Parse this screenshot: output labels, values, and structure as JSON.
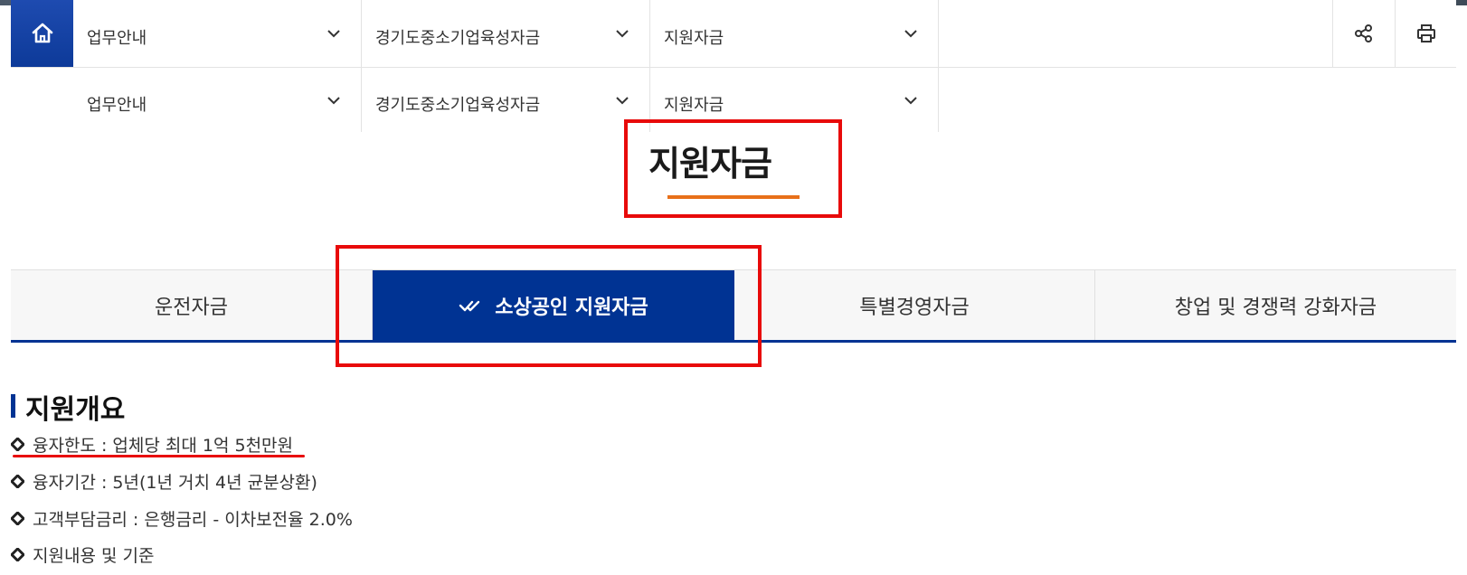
{
  "nav": {
    "row1": [
      "업무안내",
      "경기도중소기업육성자금",
      "지원자금"
    ],
    "row2": [
      "업무안내",
      "경기도중소기업육성자금",
      "지원자금"
    ]
  },
  "page_title": "지원자금",
  "tabs": [
    "운전자금",
    "소상공인 지원자금",
    "특별경영자금",
    "창업 및 경쟁력 강화자금"
  ],
  "active_tab_index": 1,
  "section_title": "지원개요",
  "items": [
    "융자한도 : 업체당 최대 1억 5천만원",
    "융자기간 : 5년(1년 거치 4년 균분상환)",
    "고객부담금리 : 은행금리 - 이차보전율 2.0%",
    "지원내용 및 기준"
  ],
  "colors": {
    "primary": "#003393",
    "accent": "#e8701a",
    "highlight": "#e80a0a"
  }
}
